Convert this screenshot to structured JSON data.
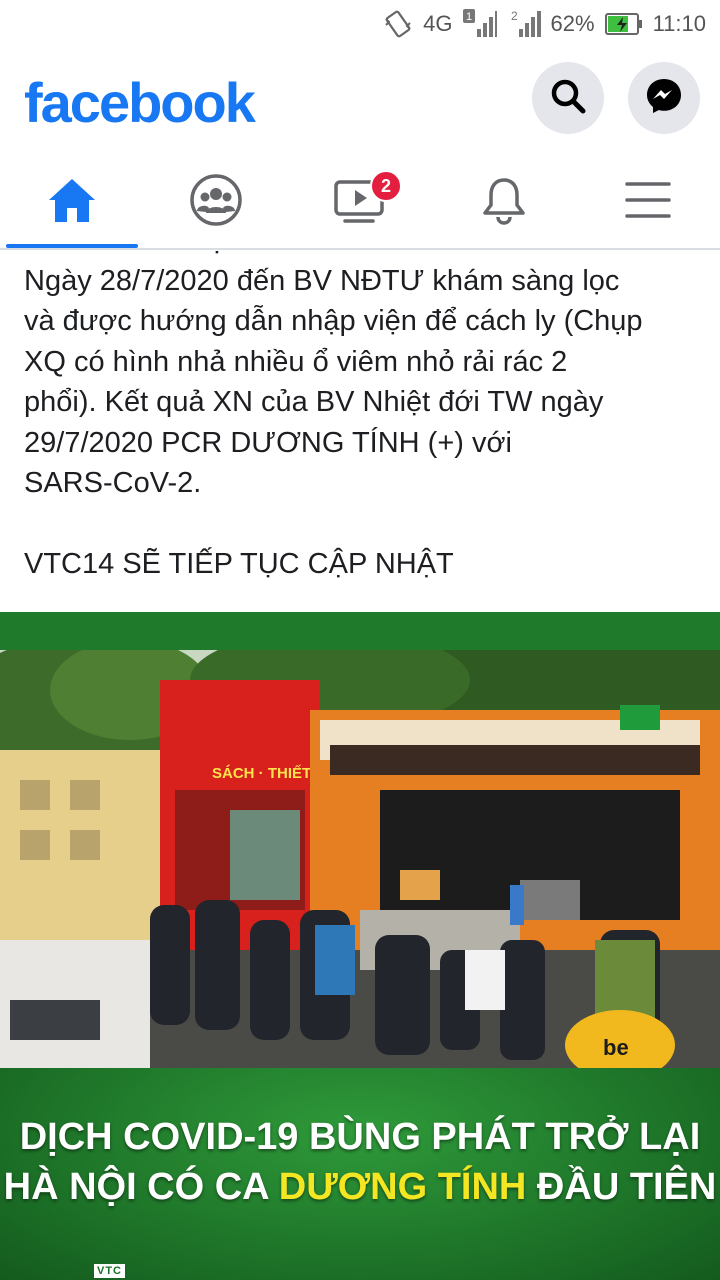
{
  "status_bar": {
    "network": "4G",
    "sim1": "1",
    "sim2": "2",
    "battery_percent": "62%",
    "battery_level": 0.62,
    "time": "11:10"
  },
  "header": {
    "logo": "facebook",
    "brand_color": "#1877f2"
  },
  "nav": {
    "tabs": [
      {
        "icon": "home-icon",
        "active": true
      },
      {
        "icon": "groups-icon",
        "active": false
      },
      {
        "icon": "watch-icon",
        "badge": "2",
        "active": false
      },
      {
        "icon": "bell-icon",
        "active": false
      },
      {
        "icon": "menu-icon",
        "active": false
      }
    ]
  },
  "post": {
    "cut_line": "kèm có đờm đặc.",
    "lines": [
      "Ngày 28/7/2020 đến BV NĐTƯ khám sàng lọc",
      "và được hướng dẫn nhập viện để cách ly (Chụp",
      "XQ có hình nhả nhiều ổ viêm nhỏ rải rác 2",
      "phổi). Kết quả XN của BV Nhiệt đới TW ngày",
      "29/7/2020 PCR DƯƠNG TÍNH (+) với",
      "SARS-CoV-2."
    ],
    "closing": "VTC14 SẼ TIẾP TỤC CẬP NHẬT"
  },
  "image": {
    "headline_line1": "DỊCH COVID-19 BÙNG PHÁT TRỞ LẠI",
    "headline_line2_prefix": "HÀ NỘI CÓ CA ",
    "headline_line2_highlight": "DƯƠNG TÍNH",
    "headline_line2_suffix": " ĐẦU TIÊN",
    "shop_sign": "SÁCH · THIẾT BỊ GIÁO DỤC",
    "logo_text": "VTC"
  }
}
